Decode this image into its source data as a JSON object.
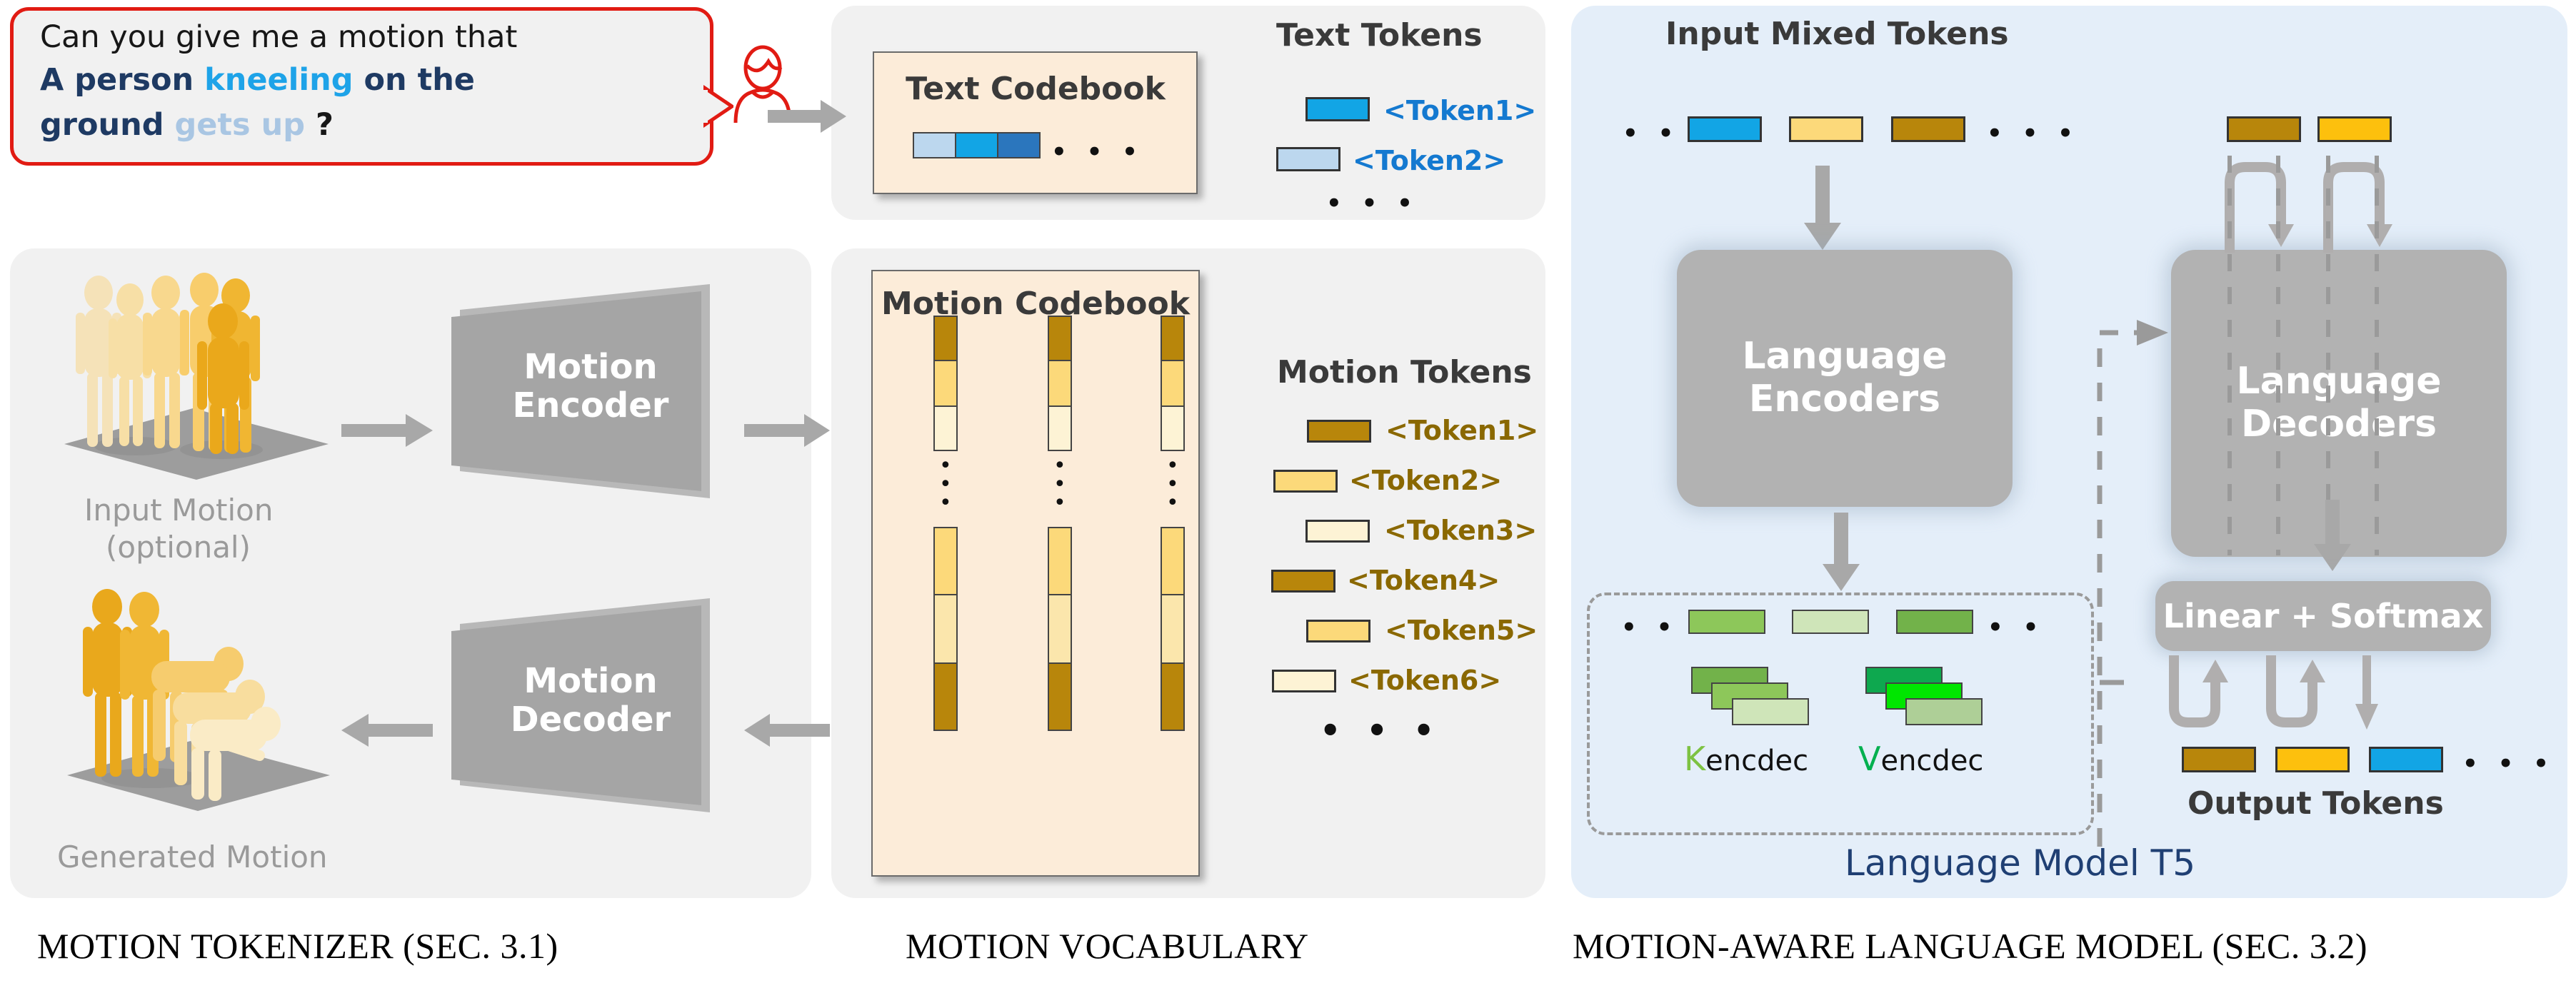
{
  "prompt_bubble": {
    "line1": "Can you give me a motion that",
    "line2_a": "A person ",
    "line2_b": "kneeling",
    "line2_c": " on the",
    "line3_a": "ground ",
    "line3_b": "gets up",
    "line3_c": " ?",
    "border_color": "#e11b13",
    "bg_color": "#f1f1f1"
  },
  "text_vocab": {
    "codebook_title": "Text Codebook",
    "codebook_cells": [
      "#bcd7ee",
      "#12a5e5",
      "#2b76bd"
    ],
    "codebook_ellipsis": "• • •",
    "tokens_title": "Text Tokens",
    "tokens": [
      {
        "label": "<Token1>",
        "color": "#12a5e5"
      },
      {
        "label": "<Token2>",
        "color": "#bcd7ee"
      }
    ],
    "tokens_ellipsis": "• • •",
    "token_text_color": "#1479d0"
  },
  "motion_tokenizer": {
    "input_label_line1": "Input Motion",
    "input_label_line2": "(optional)",
    "output_label": "Generated Motion",
    "encoder_label_line1": "Motion",
    "encoder_label_line2": "Encoder",
    "decoder_label_line1": "Motion",
    "decoder_label_line2": "Decoder"
  },
  "motion_vocab": {
    "codebook_title": "Motion Codebook",
    "column_top_cells": [
      "#b8860b",
      "#fcd97a",
      "#fdf3d5"
    ],
    "column_bottom_cells": [
      "#fcd97a",
      "#fbe6ac",
      "#b8860b"
    ],
    "column_ellipsis": "•",
    "tokens_title": "Motion Tokens",
    "tokens": [
      {
        "label": "<Token1>",
        "color": "#b8860b"
      },
      {
        "label": "<Token2>",
        "color": "#fcd97a"
      },
      {
        "label": "<Token3>",
        "color": "#fdf3d5"
      },
      {
        "label": "<Token4>",
        "color": "#b8860b"
      },
      {
        "label": "<Token5>",
        "color": "#fcd97a"
      },
      {
        "label": "<Token6>",
        "color": "#fdf3d5"
      }
    ],
    "tokens_ellipsis": "• • •",
    "token_text_color": "#8a6800"
  },
  "language_model": {
    "input_title": "Input Mixed Tokens",
    "input_tokens": [
      "#12a5e5",
      "#fcd97a",
      "#b8860b"
    ],
    "input_ellipsis_left": "• • •",
    "input_ellipsis_right": "• • •",
    "decoder_input_tokens": [
      "#b8860b",
      "#fdc00d"
    ],
    "encoder_label_line1": "Language",
    "encoder_label_line2": "Encoders",
    "decoder_label_line1": "Language",
    "decoder_label_line2": "Decoders",
    "memory_tokens": [
      "#8dc75a",
      "#cfe5b9",
      "#72b24a"
    ],
    "memory_ellipsis_left": "• • •",
    "memory_ellipsis_right": "• •",
    "k_stack": [
      "#72b24a",
      "#8dc75a",
      "#cfe5b9"
    ],
    "v_stack": [
      "#0ea84f",
      "#00e600",
      "#aecf97"
    ],
    "k_label_initial": "K",
    "k_label_rest": "encdec",
    "v_label_initial": "V",
    "v_label_rest": "encdec",
    "linear_softmax_label": "Linear + Softmax",
    "output_tokens": [
      "#b8860b",
      "#fdc00d",
      "#12a5e5"
    ],
    "output_ellipsis": "• • •",
    "output_title": "Output Tokens",
    "model_title": "Language Model T5",
    "model_title_color": "#1f3f73",
    "panel_bg": "#e4eef9"
  },
  "captions": {
    "left": "MOTION TOKENIZER (SEC. 3.1)",
    "middle": "MOTION VOCABULARY",
    "right": "MOTION-AWARE LANGUAGE MODEL (SEC. 3.2)"
  }
}
